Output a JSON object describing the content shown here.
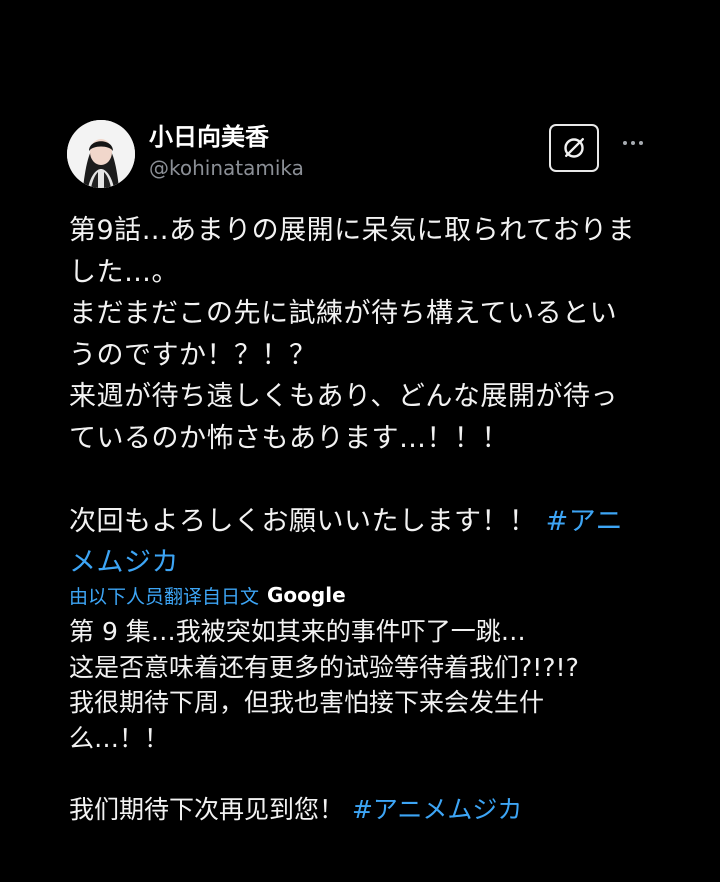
{
  "user": {
    "display_name": "小日向美香",
    "handle": "@kohinatamika"
  },
  "actions": {
    "grok_icon": "grok-icon",
    "more_icon": "more-icon"
  },
  "post": {
    "lines": [
      "第9話…あまりの展開に呆気に取られておりま",
      "した…。",
      "まだまだこの先に試練が待ち構えているとい",
      "うのですか！？！？",
      "来週が待ち遠しくもあり、どんな展開が待っ",
      "ているのか怖さもあります…！！！",
      "次回もよろしくお願いいたします！！",
      "#アニ",
      "メムジカ"
    ]
  },
  "translation": {
    "label": "由以下人员翻译自日文",
    "provider": "Google",
    "lines": [
      "第 9 集…我被突如其来的事件吓了一跳…",
      "这是否意味着还有更多的试验等待着我们?!?!?",
      "我很期待下周，但我也害怕接下来会发生什",
      "么…！！",
      "我们期待下次再见到您！",
      "#アニメムジカ"
    ]
  },
  "colors": {
    "background": "#000000",
    "text": "#f2f2f2",
    "secondary": "#8b8f96",
    "accent": "#3da5f5"
  }
}
